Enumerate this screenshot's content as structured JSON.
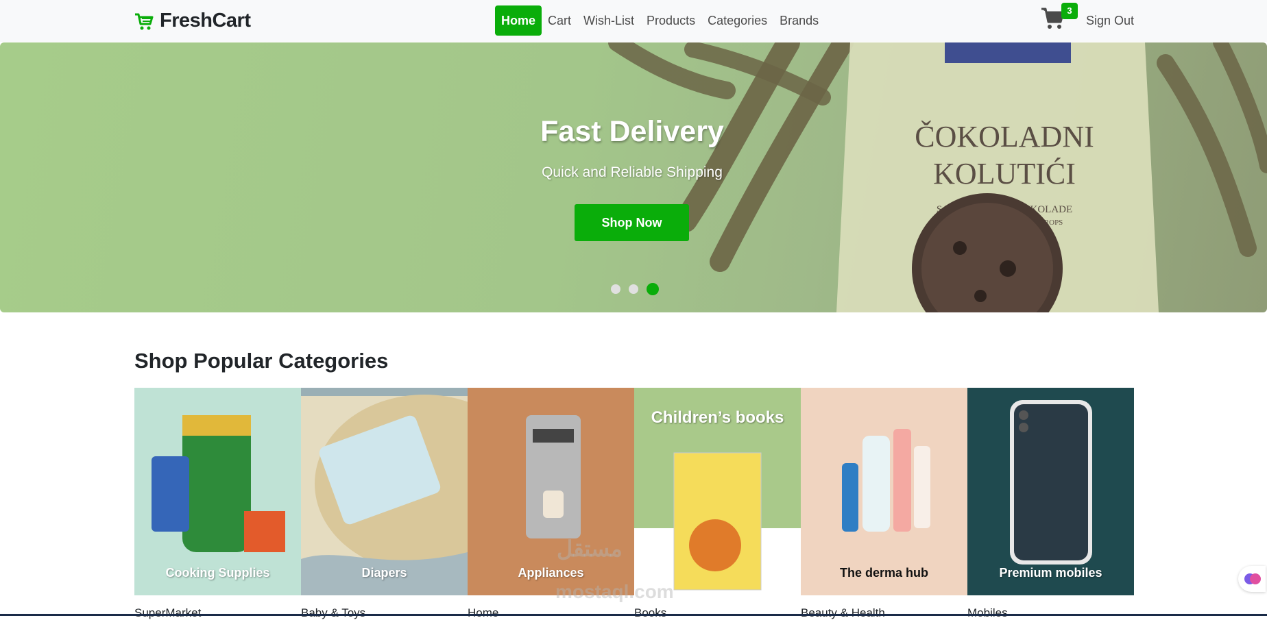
{
  "brand": {
    "name": "FreshCart",
    "icon": "cart-icon"
  },
  "nav": {
    "items": [
      {
        "label": "Home",
        "active": true
      },
      {
        "label": "Cart"
      },
      {
        "label": "Wish-List"
      },
      {
        "label": "Products"
      },
      {
        "label": "Categories"
      },
      {
        "label": "Brands"
      }
    ],
    "cart_count": "3",
    "signout": "Sign Out"
  },
  "hero": {
    "title": "Fast Delivery",
    "subtitle": "Quick and Reliable Shipping",
    "button": "Shop Now",
    "slides": 3,
    "active_slide": 3,
    "package_text_1": "ČOKOLADNI",
    "package_text_2": "KOLUTIĆI",
    "package_text_3": "S KOMADIČIMA ČOKOLADE",
    "package_text_4": "RINGS WITH CHOCOLATE DROPS"
  },
  "categories": {
    "title": "Shop Popular Categories",
    "items": [
      {
        "caption": "Cooking Supplies",
        "name": "SuperMarket",
        "bg": "#bfe2d5"
      },
      {
        "caption": "Diapers",
        "name": "Baby & Toys",
        "bg": "#e5dcc0"
      },
      {
        "caption": "Appliances",
        "name": "Home",
        "bg": "#c98a5c"
      },
      {
        "caption": "Children’s books",
        "name": "Books",
        "bg": "#a9c98a"
      },
      {
        "caption": "The derma hub",
        "name": "Beauty & Health",
        "bg": "#f0d4c0"
      },
      {
        "caption": "Premium mobiles",
        "name": "Mobiles",
        "bg": "#1f4a4f"
      }
    ]
  },
  "watermark": {
    "text": "مستقل",
    "sub": "mostaql.com"
  },
  "colors": {
    "accent": "#0aad0a",
    "navbar_bg": "#f8f9fa"
  }
}
